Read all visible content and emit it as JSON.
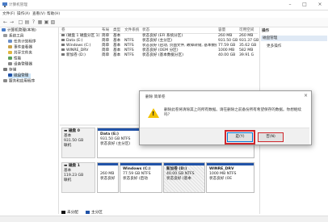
{
  "window": {
    "title": "计算机管理",
    "minimize": "–",
    "maximize": "□",
    "close": "×"
  },
  "menu": [
    "文件(F)",
    "操作(A)",
    "查看(V)",
    "帮助(H)"
  ],
  "toolbar": {
    "back": "←",
    "forward": "→",
    "icons": [
      "□",
      "▤",
      "?",
      "▦",
      "▣",
      "▧"
    ]
  },
  "tree": [
    {
      "label": "计算机管理(本地)",
      "level": 0
    },
    {
      "label": "系统工具",
      "level": 1
    },
    {
      "label": "任务计划程序",
      "level": 2
    },
    {
      "label": "事件查看器",
      "level": 2
    },
    {
      "label": "共享文件夹",
      "level": 2
    },
    {
      "label": "性能",
      "level": 2
    },
    {
      "label": "设备管理器",
      "level": 2
    },
    {
      "label": "存储",
      "level": 1
    },
    {
      "label": "磁盘管理",
      "level": 2,
      "selected": true
    },
    {
      "label": "服务和应用程序",
      "level": 1
    }
  ],
  "volume_list": {
    "headers": [
      "卷",
      "布局",
      "类型",
      "文件系统",
      "状态",
      "容量",
      "可用空间"
    ],
    "rows": [
      [
        "(磁盘 1 磁盘分区 1)",
        "简单",
        "基本",
        "",
        "状态良好 (EFI 系统分区)",
        "260 MB",
        "260 MB"
      ],
      [
        "Data (E:)",
        "简单",
        "基本",
        "NTFS",
        "状态良好 (主分区)",
        "931.50 GB",
        "931.37 GB"
      ],
      [
        "Windows (C:)",
        "简单",
        "基本",
        "NTFS",
        "状态良好 (启动, 页面文件, 故障转储, 基本数据分区)",
        "77.59 GB",
        "35.62 GB"
      ],
      [
        "WINRE_DRV",
        "简单",
        "基本",
        "NTFS",
        "状态良好 (OEM 分区)",
        "1000 MB",
        "582 MB"
      ],
      [
        "新加卷 (D:)",
        "简单",
        "基本",
        "NTFS",
        "状态良好 (基本数据分区)",
        "40.00 GB",
        "39.91 G"
      ]
    ]
  },
  "actions": {
    "header": "操作",
    "section": "磁盘管理",
    "more": "更多操作"
  },
  "disks": [
    {
      "name": "磁盘 0",
      "type": "基本",
      "size": "931.50 GB",
      "status": "联机",
      "partitions": [
        {
          "name": "Data (E:)",
          "size": "931.50 GB NTFS",
          "status": "状态良好 (主分区)"
        }
      ]
    },
    {
      "name": "磁盘 1",
      "type": "基本",
      "size": "119.23 GB",
      "status": "联机",
      "partitions": [
        {
          "name": "",
          "size": "260 MB",
          "status": "状态良好"
        },
        {
          "name": "Windows (C:)",
          "size": "77.59 GB NTFS",
          "status": "状态良好 (启动"
        },
        {
          "name": "新加卷 (D:)",
          "size": "40.00 GB NTFS",
          "status": "状态良好 (基本"
        },
        {
          "name": "WINRE_DRV",
          "size": "1000 MB NTFS",
          "status": "状态良好 (OE"
        }
      ]
    }
  ],
  "legend": [
    {
      "label": "未分配",
      "color": "#111111"
    },
    {
      "label": "主分区",
      "color": "#2153a8"
    }
  ],
  "dialog": {
    "title": "删除 简单卷",
    "message": "删除此卷将清除其上的所有数据。请在删除之前备份所有希望保存的数据。你想继续吗？",
    "yes": "是(Y)",
    "no": "否(N)",
    "close": "×"
  },
  "colors": {
    "accent": "#2153a8",
    "highlight": "#d0262b",
    "selection": "#cce4f7"
  }
}
